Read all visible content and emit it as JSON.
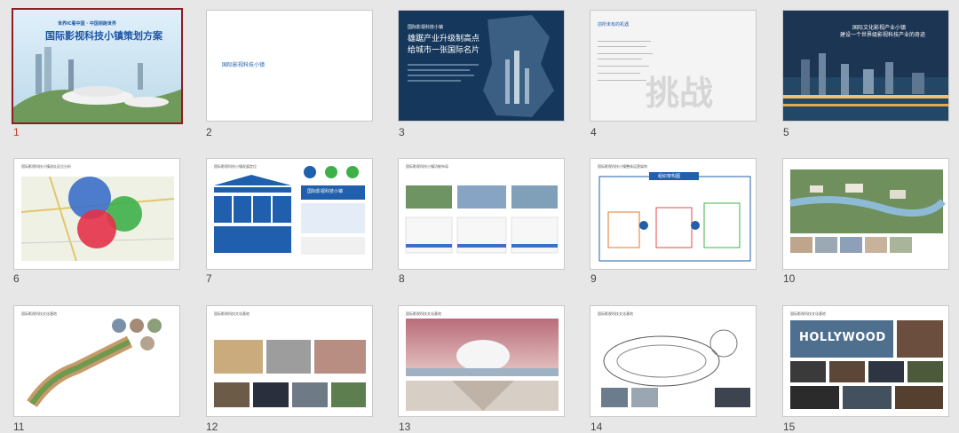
{
  "slides": [
    {
      "number": "1",
      "selected": true,
      "subtitle": "世界IC看中国 · 中国领跑世界",
      "title": "国际影视科技小镇策划方案"
    },
    {
      "number": "2",
      "title": "国际影视科技小镇"
    },
    {
      "number": "3",
      "kicker": "国际影视科技小镇",
      "headline_1": "雄踞产业升级制高点",
      "headline_2": "给城市一张国际名片"
    },
    {
      "number": "4",
      "heading": "前所未有的机遇",
      "watermark": "挑战"
    },
    {
      "number": "5",
      "headline_1": "国际文化影视产业小镇",
      "headline_2": "建设一个世界级影视科技产业的奇迹"
    },
    {
      "number": "6",
      "title": "国际影视科技小镇选址区位分析"
    },
    {
      "number": "7",
      "title": "国际影视科技小镇发展定位",
      "box_title": "国际影视科技小镇"
    },
    {
      "number": "8",
      "title": "国际影视科技小镇功能布局"
    },
    {
      "number": "9",
      "title": "国际影视科技小镇整体运营架构",
      "banner": "组织架构图"
    },
    {
      "number": "10",
      "title": "国际影视科技文化基地"
    },
    {
      "number": "11",
      "title": "国际影视科技文化基地"
    },
    {
      "number": "12",
      "title": "国际影视科技文化基地"
    },
    {
      "number": "13",
      "title": "国际影视科技文化基地"
    },
    {
      "number": "14",
      "title": "国际影视科技文化基地"
    },
    {
      "number": "15",
      "title": "国际影视科技文化基地",
      "sign": "HOLLYWOOD"
    }
  ],
  "colors": {
    "selection_border": "#8c1d22",
    "selected_number": "#c0392b",
    "panel_background": "#e7e7e7",
    "accent_blue": "#1f5fae"
  }
}
